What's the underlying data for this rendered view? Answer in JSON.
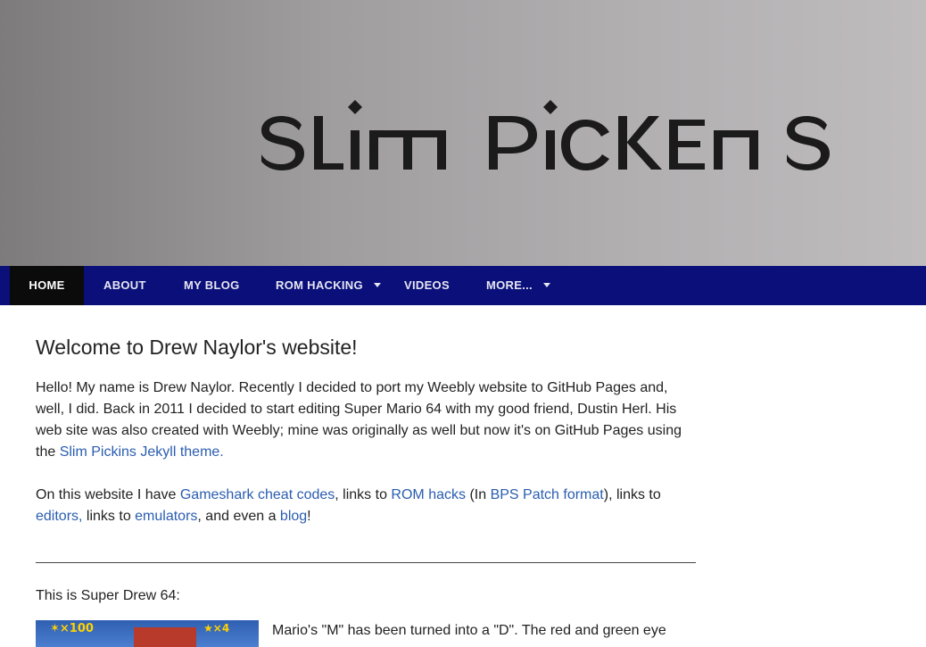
{
  "header": {
    "logo_text": "Slim Pickens"
  },
  "nav": {
    "items": [
      {
        "label": "HOME",
        "active": true,
        "dropdown": false
      },
      {
        "label": "ABOUT",
        "active": false,
        "dropdown": false
      },
      {
        "label": "MY BLOG",
        "active": false,
        "dropdown": false
      },
      {
        "label": "ROM HACKING",
        "active": false,
        "dropdown": true
      },
      {
        "label": "VIDEOS",
        "active": false,
        "dropdown": false
      },
      {
        "label": "MORE...",
        "active": false,
        "dropdown": true
      }
    ]
  },
  "main": {
    "title": "Welcome to Drew Naylor's website!",
    "intro": {
      "text1": "Hello! My name is Drew Naylor. Recently I decided to port my Weebly website to GitHub Pages and, well, I did. Back in 2011 I decided to start editing Super Mario 64 with my good friend, Dustin Herl. His web site was also created with Weebly; mine was originally as well but now it's on GitHub Pages using the ",
      "link_theme": "Slim Pickins Jekyll theme."
    },
    "features": {
      "t1": "On this website I have ",
      "link_gameshark": "Gameshark cheat codes",
      "t2": ", links to ",
      "link_romhacks": "ROM hacks",
      "t3": " (In ",
      "link_bps": "BPS Patch format",
      "t4": "), links to ",
      "link_editors": "editors,",
      "t5": " links to ",
      "link_emulators": "emulators",
      "t6": ", and even a ",
      "link_blog": "blog",
      "t7": "!"
    },
    "super_drew_caption": "This is Super Drew 64:",
    "thumbnail": {
      "hud_left": "✶×100",
      "hud_right": "★×4"
    },
    "super_drew_text": "Mario's \"M\" has been turned into a \"D\". The red and green eye"
  },
  "colors": {
    "nav_bg": "#0a0f7a",
    "nav_active_bg": "#0b0b0b",
    "link": "#2a5db0"
  }
}
